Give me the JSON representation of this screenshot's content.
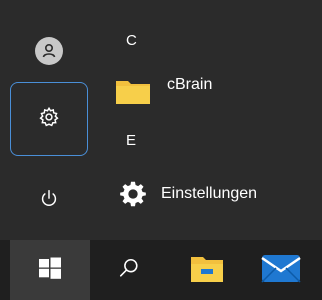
{
  "start_menu": {
    "sections": [
      {
        "letter": "C",
        "items": [
          {
            "label": "cBrain",
            "icon": "folder-icon"
          }
        ]
      },
      {
        "letter": "E",
        "items": [
          {
            "label": "Einstellungen",
            "icon": "gear-icon"
          }
        ]
      }
    ],
    "rail": {
      "buttons": [
        {
          "name": "user-account",
          "icon": "user-icon"
        },
        {
          "name": "settings",
          "icon": "gear-icon",
          "focused": true
        },
        {
          "name": "power",
          "icon": "power-icon"
        }
      ]
    }
  },
  "taskbar": {
    "buttons": [
      {
        "name": "start",
        "icon": "windows-logo-icon",
        "active": true
      },
      {
        "name": "search",
        "icon": "search-icon"
      },
      {
        "name": "file-explorer",
        "icon": "folder-icon"
      },
      {
        "name": "mail",
        "icon": "mail-icon"
      }
    ]
  },
  "colors": {
    "focus_outline": "#4a8fd8",
    "folder_yellow": "#f2c03e",
    "mail_blue": "#1f78d1",
    "background": "#2b2b2b",
    "taskbar": "#1f1f1f"
  }
}
